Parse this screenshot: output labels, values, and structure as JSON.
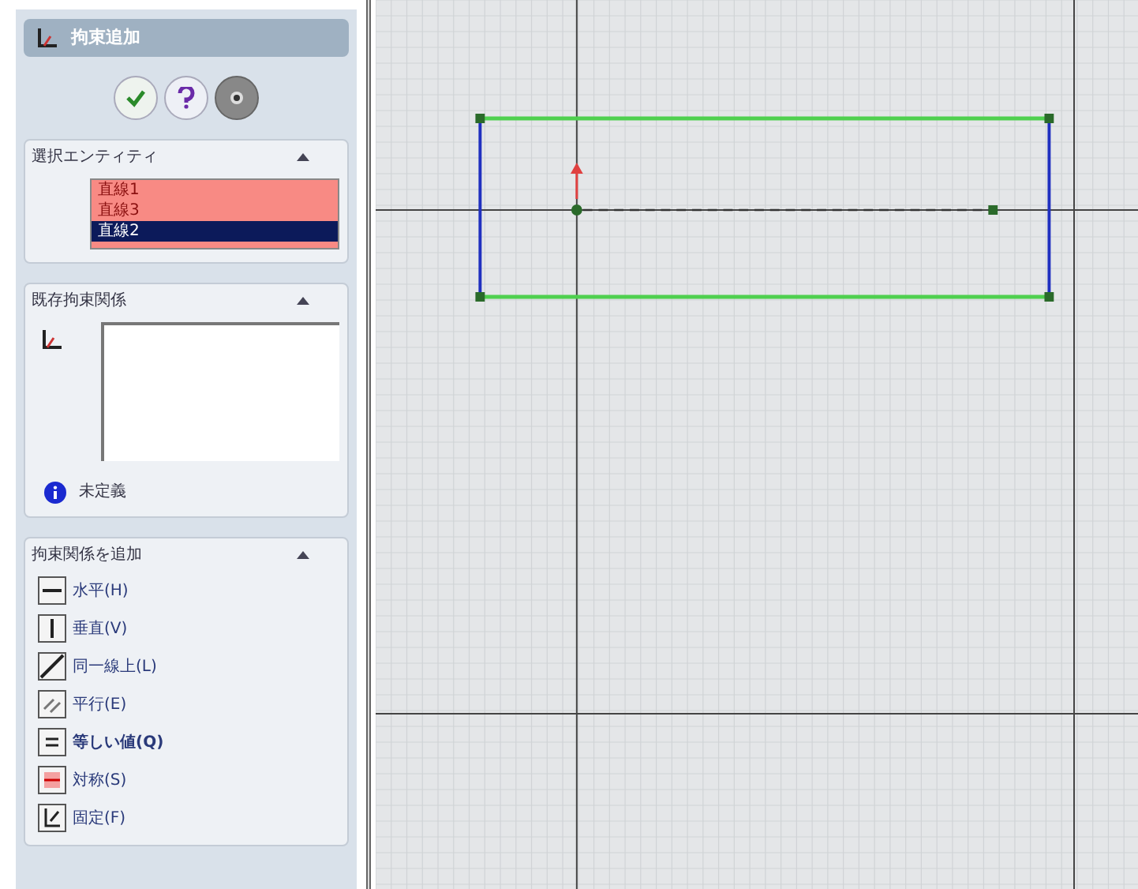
{
  "panel": {
    "title": "拘束追加"
  },
  "selected_entities": {
    "title": "選択エンティティ",
    "items": [
      {
        "label": "直線1",
        "selected": false
      },
      {
        "label": "直線3",
        "selected": false
      },
      {
        "label": "直線2",
        "selected": true
      }
    ]
  },
  "existing_relations": {
    "title": "既存拘束関係",
    "status": "未定義"
  },
  "add_relations": {
    "title": "拘束関係を追加",
    "items": [
      {
        "kind": "horizontal",
        "label": "水平(H)",
        "bold": false
      },
      {
        "kind": "vertical",
        "label": "垂直(V)",
        "bold": false
      },
      {
        "kind": "collinear",
        "label": "同一線上(L)",
        "bold": false
      },
      {
        "kind": "parallel",
        "label": "平行(E)",
        "bold": false
      },
      {
        "kind": "equal",
        "label": "等しい値(Q)",
        "bold": true
      },
      {
        "kind": "symmetric",
        "label": "対称(S)",
        "bold": false
      },
      {
        "kind": "fix",
        "label": "固定(F)",
        "bold": false
      }
    ]
  }
}
